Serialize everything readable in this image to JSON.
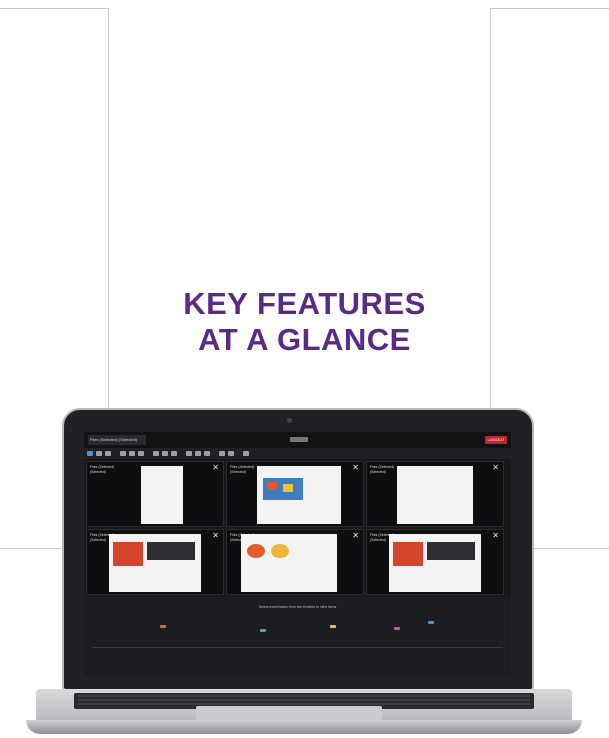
{
  "headline": {
    "line1": "KEY FEATURES",
    "line2": "AT A GLANCE"
  },
  "app": {
    "tab_label": "Files (Selected) (Selected)",
    "header_button": "LOGOUT",
    "status_message": "Select examination from the timeline to view items"
  },
  "tiles": [
    {
      "info": "Files (Selected) (Selected)"
    },
    {
      "info": "Files (Selected) (Selected)"
    },
    {
      "info": "Files (Selected) (Selected)"
    },
    {
      "info": "Files (Selected) (Selected)"
    },
    {
      "info": "Files (Selected) (Selected)"
    },
    {
      "info": "Files (Selected) (Selected)"
    }
  ],
  "colors": {
    "headline": "#5b2a86",
    "accent": "#4a90e2",
    "danger": "#c0272d"
  }
}
